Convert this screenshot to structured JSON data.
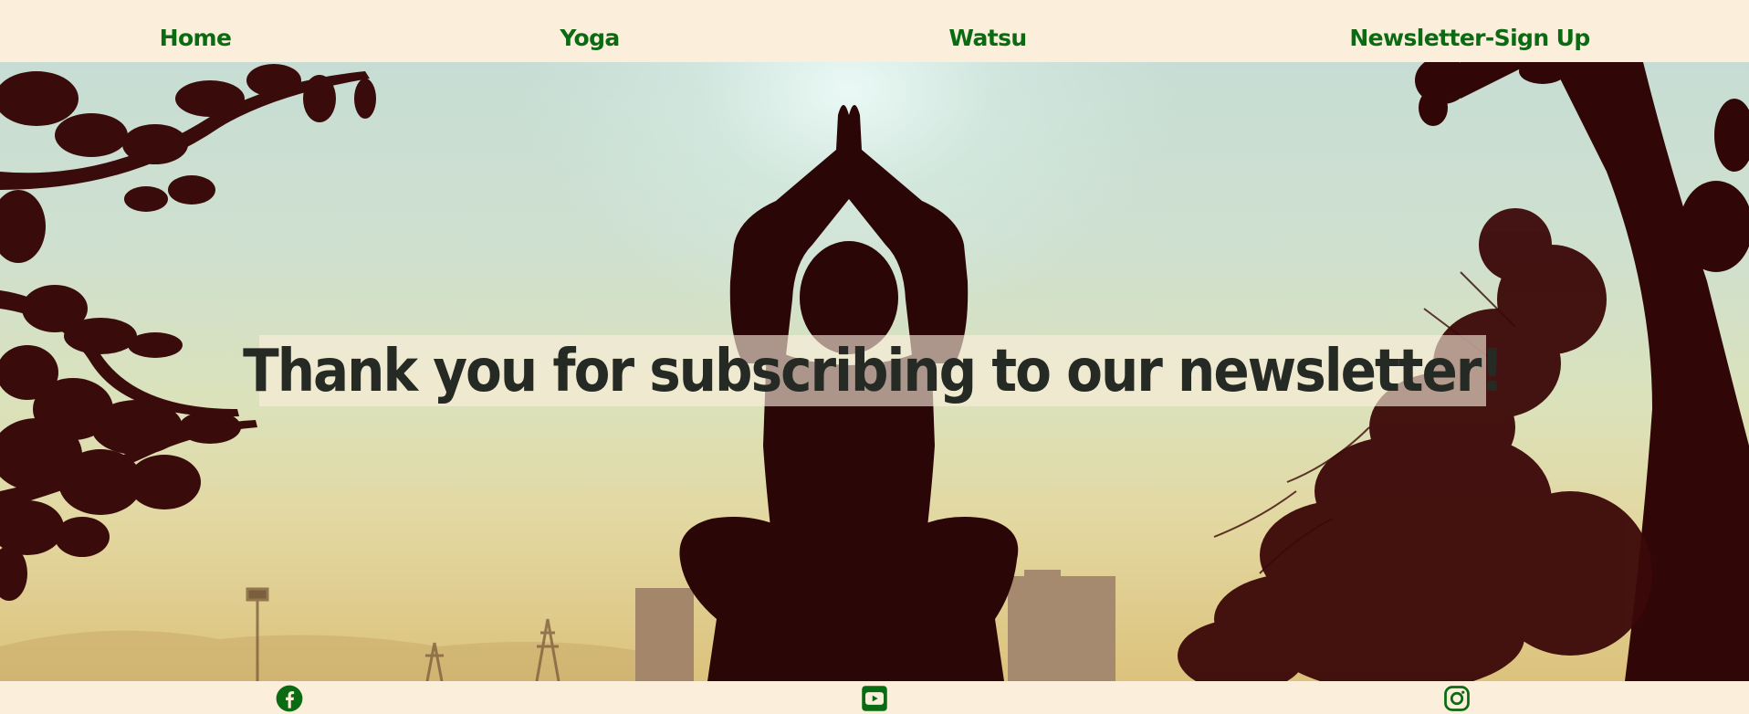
{
  "nav": {
    "items": [
      {
        "label": "Home"
      },
      {
        "label": "Yoga"
      },
      {
        "label": "Watsu"
      },
      {
        "label": "Newsletter-Sign Up"
      }
    ]
  },
  "hero": {
    "heading": "Thank you for subscribing to our newsletter!",
    "image": "yoga-silhouette-sunset"
  },
  "footer": {
    "social_icons": [
      "facebook-icon",
      "youtube-icon",
      "instagram-icon"
    ]
  },
  "colors": {
    "background": "#fbeedb",
    "nav_text": "#0b6b12",
    "heading_text": "#262a25",
    "silhouette": "#2a0606"
  }
}
